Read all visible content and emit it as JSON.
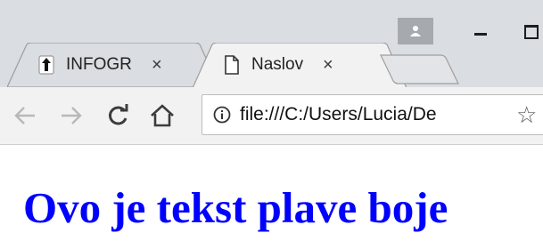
{
  "window": {
    "controls": [
      "minimize",
      "maximize"
    ]
  },
  "tabs": [
    {
      "title": "INFOGR",
      "favicon": "graduation-icon",
      "active": false,
      "close": "×"
    },
    {
      "title": "Naslov",
      "favicon": "page-icon",
      "active": true,
      "close": "×"
    }
  ],
  "toolbar": {
    "url": "file:///C:/Users/Lucia/De",
    "icons": [
      "back-arrow-icon",
      "forward-arrow-icon",
      "reload-icon",
      "home-icon",
      "info-icon",
      "star-icon"
    ]
  },
  "page": {
    "heading": "Ovo je tekst plave boje",
    "heading_color": "#0000ff"
  }
}
